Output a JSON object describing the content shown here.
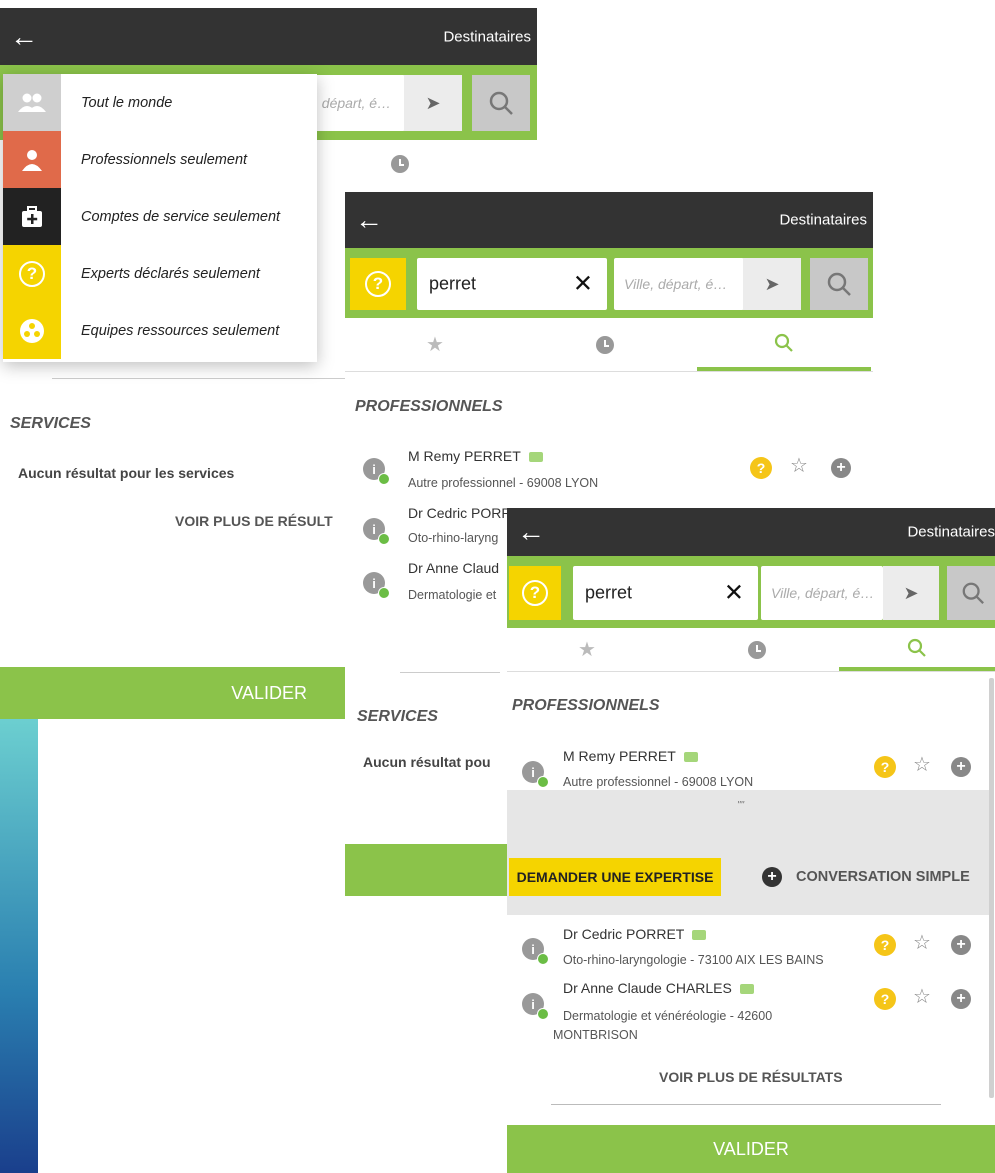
{
  "colors": {
    "green": "#8bc34a",
    "dark": "#333333",
    "yellow": "#f5d400",
    "gray": "#999999"
  },
  "header": {
    "title": "Destinataires"
  },
  "search": {
    "query": "perret",
    "city_placeholder": "Ville, départ, é…",
    "city_placeholder_back": ", départ, é…"
  },
  "dropdown": {
    "items": [
      {
        "label": "Tout le monde",
        "icon": "group-icon"
      },
      {
        "label": "Professionnels seulement",
        "icon": "person-icon"
      },
      {
        "label": "Comptes de service seulement",
        "icon": "medkit-icon"
      },
      {
        "label": "Experts déclarés seulement",
        "icon": "question-icon"
      },
      {
        "label": "Equipes ressources seulement",
        "icon": "team-icon"
      }
    ]
  },
  "sections": {
    "professionals": "PROFESSIONNELS",
    "services": "SERVICES"
  },
  "no_result_services": "Aucun résultat pour les services",
  "no_result_services_short": "Aucun résultat pou",
  "see_more": "VOIR PLUS DE RÉSULTATS",
  "see_more_partial": "VOIR PLUS DE RÉSULT",
  "see_more_partial2": "ULT.",
  "validate": "VALIDER",
  "actions": {
    "expertise": "DEMANDER UNE EXPERTISE",
    "conversation": "CONVERSATION SIMPLE",
    "handle": "\"\""
  },
  "professionals": [
    {
      "name": "M Remy PERRET",
      "detail": "Autre professionnel - 69008 LYON"
    },
    {
      "name": "Dr Cedric PORRET",
      "detail": "Oto-rhino-laryngologie - 73100 AIX LES BAINS"
    },
    {
      "name": "Dr Anne Claude CHARLES",
      "detail": "Dermatologie et vénéréologie - 42600",
      "detail2": "MONTBRISON"
    }
  ],
  "partial": {
    "cedric": "Dr Cedric PORR",
    "cedric_sub": "Oto-rhino-laryng",
    "anne": "Dr Anne Claud",
    "anne_sub": "Dermatologie et"
  }
}
